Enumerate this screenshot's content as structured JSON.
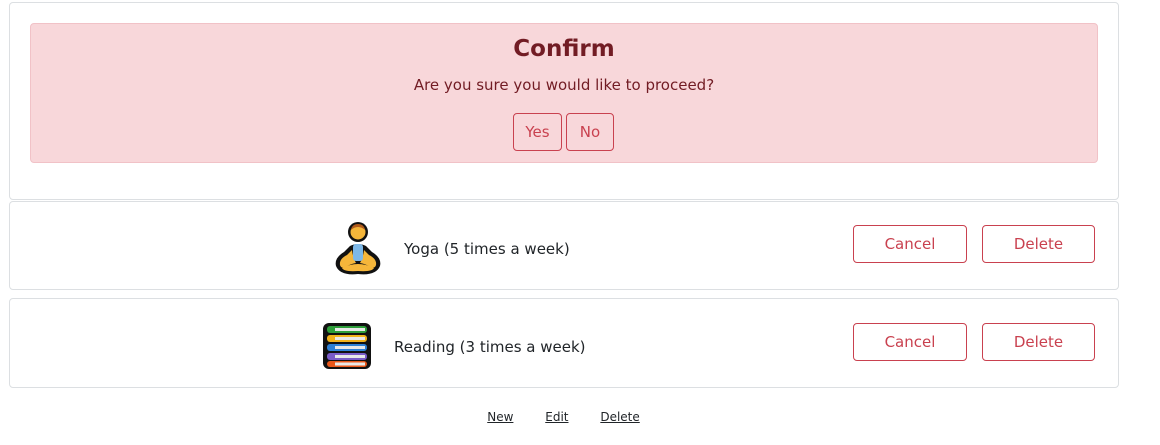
{
  "confirm": {
    "title": "Confirm",
    "message": "Are you sure you would like to proceed?",
    "yes_label": "Yes",
    "no_label": "No"
  },
  "items": [
    {
      "icon": "yoga-person-icon",
      "label": "Yoga (5 times a week)",
      "cancel_label": "Cancel",
      "delete_label": "Delete"
    },
    {
      "icon": "books-stack-icon",
      "label": "Reading (3 times a week)",
      "cancel_label": "Cancel",
      "delete_label": "Delete"
    }
  ],
  "footer": {
    "links": [
      "New",
      "Edit",
      "Delete"
    ]
  },
  "colors": {
    "alert_bg": "#f8d7da",
    "alert_text": "#721c24",
    "danger": "#c9414f"
  }
}
